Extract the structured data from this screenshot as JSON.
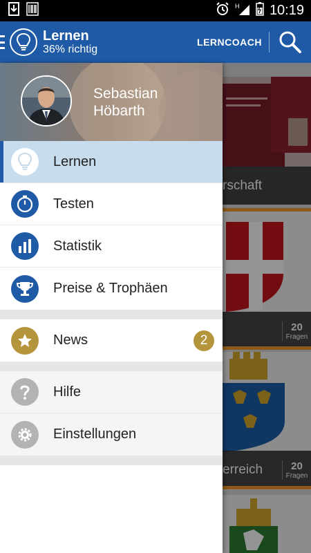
{
  "status_bar": {
    "time": "10:19",
    "icons": [
      "download-icon",
      "barcode-icon",
      "alarm-icon",
      "signal-icon",
      "battery-icon"
    ],
    "network_label": "H"
  },
  "app_bar": {
    "title": "Lernen",
    "subtitle": "36% richtig",
    "action_label": "LERNCOACH",
    "icons": [
      "menu-icon",
      "lightbulb-icon",
      "search-icon"
    ],
    "color": "#1f5aa6"
  },
  "drawer": {
    "user_name_first": "Sebastian",
    "user_name_last": "Höbarth",
    "primary_items": [
      {
        "label": "Lernen",
        "icon": "lightbulb-icon",
        "active": true
      },
      {
        "label": "Testen",
        "icon": "stopwatch-icon"
      },
      {
        "label": "Statistik",
        "icon": "bar-chart-icon"
      },
      {
        "label": "Preise & Trophäen",
        "icon": "trophy-icon"
      }
    ],
    "news": {
      "label": "News",
      "icon": "star-icon",
      "badge": "2",
      "color": "#b5953c"
    },
    "secondary_items": [
      {
        "label": "Hilfe",
        "icon": "question-icon"
      },
      {
        "label": "Einstellungen",
        "icon": "gear-icon"
      }
    ]
  },
  "background": {
    "cards": [
      {
        "label": "rschaft"
      },
      {
        "label": "",
        "count": "20",
        "unit": "Fragen"
      },
      {
        "label": "erreich",
        "count": "20",
        "unit": "Fragen"
      }
    ]
  }
}
